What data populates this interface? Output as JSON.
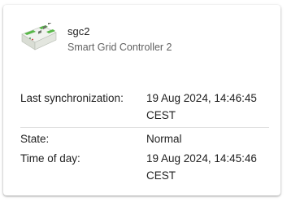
{
  "device": {
    "name": "sgc2",
    "description": "Smart Grid Controller 2",
    "image_icon": "din-rail-controller-icon"
  },
  "rows": [
    {
      "label": "Last synchronization:",
      "value": "19 Aug 2024, 14:46:45 CEST"
    },
    {
      "label": "State:",
      "value": "Normal"
    },
    {
      "label": "Time of day:",
      "value": "19 Aug 2024, 14:45:46 CEST"
    }
  ],
  "colors": {
    "device_body": "#e9ece6",
    "device_green_terminal": "#58b848",
    "divider": "#e0e0e0"
  }
}
